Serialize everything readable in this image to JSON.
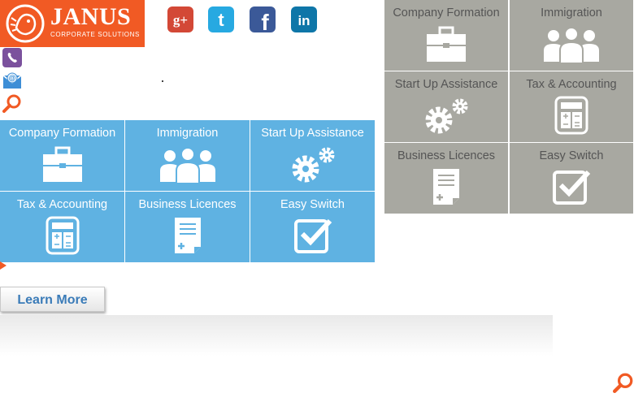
{
  "logo": {
    "brand": "JANUS",
    "sub": "CORPORATE SOLUTIONS"
  },
  "social": [
    {
      "name": "google-plus",
      "glyph": "g+",
      "color": "#d34836"
    },
    {
      "name": "twitter",
      "glyph": "t",
      "color": "#27a9e1"
    },
    {
      "name": "facebook",
      "glyph": "f",
      "color": "#3b5998"
    },
    {
      "name": "linkedin",
      "glyph": "in",
      "color": "#0e76a8"
    }
  ],
  "services_blue": [
    {
      "label": "Company Formation",
      "icon": "briefcase-icon"
    },
    {
      "label": "Immigration",
      "icon": "people-icon"
    },
    {
      "label": "Start Up Assistance",
      "icon": "gears-icon"
    },
    {
      "label": "Tax & Accounting",
      "icon": "calculator-icon"
    },
    {
      "label": "Business Licences",
      "icon": "document-icon"
    },
    {
      "label": "Easy Switch",
      "icon": "checkbox-icon"
    }
  ],
  "services_gray": [
    {
      "label": "Company Formation",
      "icon": "briefcase-icon"
    },
    {
      "label": "Immigration",
      "icon": "people-icon"
    },
    {
      "label": "Start Up Assistance",
      "icon": "gears-icon"
    },
    {
      "label": "Tax & Accounting",
      "icon": "calculator-icon"
    },
    {
      "label": "Business Licences",
      "icon": "document-icon"
    },
    {
      "label": "Easy Switch",
      "icon": "checkbox-icon"
    }
  ],
  "cta": {
    "label": "Learn More"
  },
  "colors": {
    "brand": "#f15a24",
    "tile_blue": "#5fb2e2",
    "tile_gray": "#a8a8a1"
  }
}
